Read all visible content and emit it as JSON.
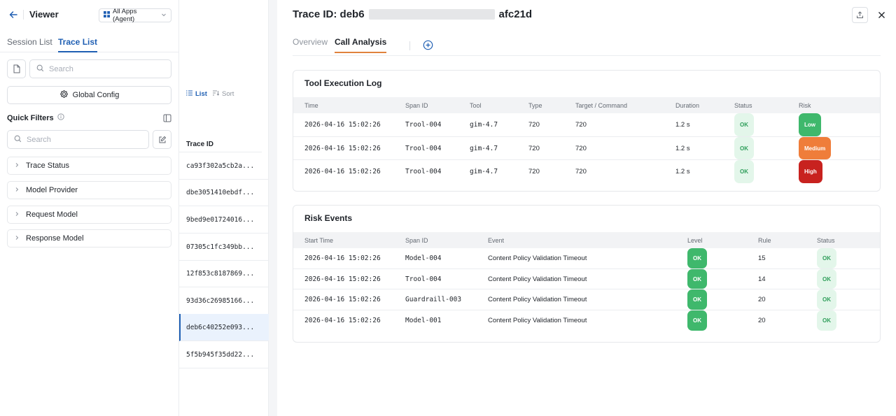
{
  "header": {
    "title": "Viewer",
    "app_select": "All Apps (Agent)"
  },
  "left_tabs": [
    {
      "label": "Session List",
      "active": false
    },
    {
      "label": "Trace List",
      "active": true
    }
  ],
  "search": {
    "placeholder": "Search"
  },
  "global_config": "Global Config",
  "quick_filters": {
    "title": "Quick Filters",
    "search_placeholder": "Search",
    "items": [
      "Trace Status",
      "Model Provider",
      "Request Model",
      "Response Model"
    ]
  },
  "trace_list": {
    "view_list": "List",
    "view_sort": "Sort",
    "header": "Trace ID",
    "rows": [
      "ca93f302a5cb2a...",
      "dbe3051410ebdf...",
      "9bed9e01724016...",
      "07305c1fc349bb...",
      "12f853c8187869...",
      "93d36c26985166...",
      "deb6c40252e093...",
      "5f5b945f35dd22..."
    ],
    "selected_index": 6
  },
  "detail": {
    "title_prefix": "Trace ID: deb6",
    "title_suffix": "afc21d",
    "tabs": [
      {
        "label": "Overview",
        "active": false
      },
      {
        "label": "Call Analysis",
        "active": true
      }
    ],
    "tool_log": {
      "title": "Tool Execution Log",
      "columns": [
        "Time",
        "Span ID",
        "Tool",
        "Type",
        "Target / Command",
        "Duration",
        "Status",
        "Risk"
      ],
      "rows": [
        {
          "time": "2026-04-16 15:02:26",
          "span": "Trool-004",
          "tool": "gim-4.7",
          "type": "720",
          "target": "720",
          "duration": "1.2 s",
          "status": "OK",
          "risk": "Low"
        },
        {
          "time": "2026-04-16 15:02:26",
          "span": "Trool-004",
          "tool": "gim-4.7",
          "type": "720",
          "target": "720",
          "duration": "1.2 s",
          "status": "OK",
          "risk": "Medium"
        },
        {
          "time": "2026-04-16 15:02:26",
          "span": "Trool-004",
          "tool": "gim-4.7",
          "type": "720",
          "target": "720",
          "duration": "1.2 s",
          "status": "OK",
          "risk": "High"
        }
      ]
    },
    "risk_events": {
      "title": "Risk Events",
      "columns": [
        "Start Time",
        "Span ID",
        "Event",
        "Level",
        "Rule",
        "Status"
      ],
      "rows": [
        {
          "time": "2026-04-16 15:02:26",
          "span": "Model-004",
          "event": "Content Policy Validation Timeout",
          "level": "OK",
          "rule": "15",
          "status": "OK"
        },
        {
          "time": "2026-04-16 15:02:26",
          "span": "Trool-004",
          "event": "Content Policy Validation Timeout",
          "level": "OK",
          "rule": "14",
          "status": "OK"
        },
        {
          "time": "2026-04-16 15:02:26",
          "span": "Guardraill-003",
          "event": "Content Policy Validation Timeout",
          "level": "OK",
          "rule": "20",
          "status": "OK"
        },
        {
          "time": "2026-04-16 15:02:26",
          "span": "Model-001",
          "event": "Content Policy Validation Timeout",
          "level": "OK",
          "rule": "20",
          "status": "OK"
        }
      ]
    }
  },
  "colors": {
    "accent": "#1f5fb3",
    "tab_underline": "#e0823d",
    "ok": "#3fb86c",
    "medium": "#ef7d3a",
    "high": "#c8221f"
  }
}
